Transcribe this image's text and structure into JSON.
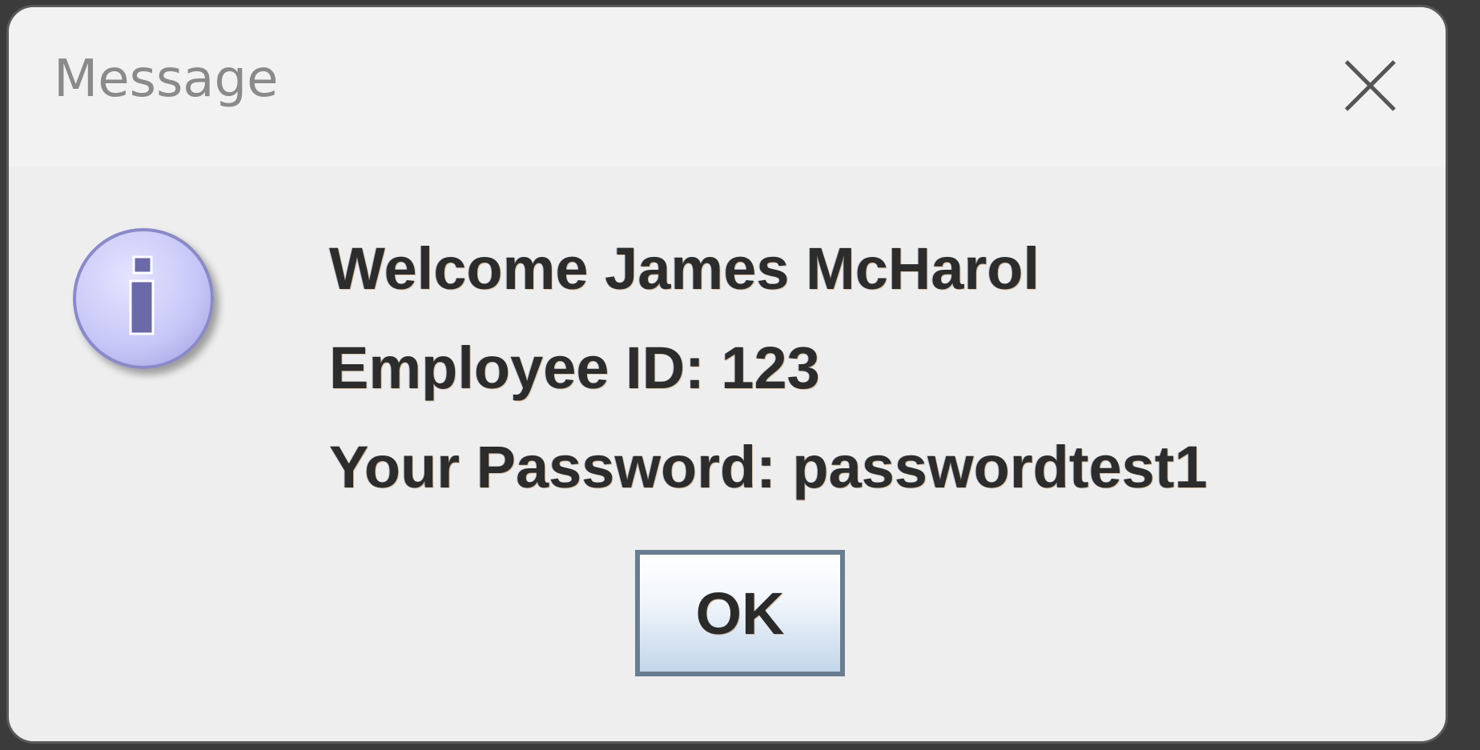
{
  "window": {
    "title": "Message",
    "close_icon": "close-icon"
  },
  "message": {
    "icon": "information-icon",
    "line1": "Welcome James McHarol",
    "line2": "Employee ID: 123",
    "line3": "Your Password: passwordtest1"
  },
  "buttons": {
    "ok_label": "OK"
  },
  "colors": {
    "title_text": "#8a8a8a",
    "dialog_bg": "#eeeeee",
    "titlebar_bg": "#f2f2f2",
    "icon_fill": "#ccccff",
    "icon_border": "#8a8ac8",
    "button_border": "#6a7d90"
  }
}
